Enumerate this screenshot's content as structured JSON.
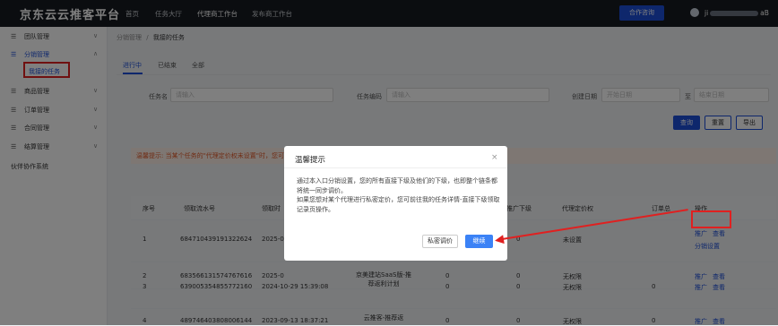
{
  "topbar": {
    "brand": "京东云云推客平台",
    "nav": [
      "首页",
      "任务大厅",
      "代理商工作台",
      "发布商工作台"
    ],
    "coop_button": "合作咨询",
    "user_prefix": "ji",
    "user_suffix": "aB"
  },
  "sidebar": {
    "items": [
      {
        "label": "团队管理",
        "chev": "∨"
      },
      {
        "label": "分销管理",
        "chev": "∧"
      },
      {
        "label": "商品管理",
        "chev": "∨"
      },
      {
        "label": "订单管理",
        "chev": "∨"
      },
      {
        "label": "合同管理",
        "chev": "∨"
      },
      {
        "label": "结算管理",
        "chev": "∨"
      }
    ],
    "sub_item": "我接的任务",
    "partner": "伙伴协作系统"
  },
  "breadcrumb": {
    "parent": "分销管理",
    "sep": "/",
    "current": "我接的任务"
  },
  "tabs": [
    "进行中",
    "已结束",
    "全部"
  ],
  "filters": {
    "task_name_label": "任务名",
    "task_name_placeholder": "请输入",
    "task_code_label": "任务编码",
    "task_code_placeholder": "请输入",
    "date_label": "创建日期",
    "start_placeholder": "开始日期",
    "date_sep": "至",
    "end_placeholder": "结束日期"
  },
  "buttons": {
    "query": "查询",
    "reset": "重置",
    "export": "导出"
  },
  "hint": "温馨提示: 当某个任务的\"代理定价权未设置\"时，您可",
  "table": {
    "headers": [
      "序号",
      "领取流水号",
      "领取时",
      "推广下级",
      "代理定价权",
      "订单总",
      "操作"
    ],
    "rows": [
      {
        "no": "1",
        "serial": "684710439191322624",
        "time": "2025-0",
        "task": "",
        "c1": "0",
        "c2": "0",
        "pricing": "未设置",
        "orders": "",
        "ops": [
          "推广",
          "查看",
          "分销设置"
        ]
      },
      {
        "no": "2",
        "serial": "683566131574767616",
        "time": "2025-0",
        "task": "",
        "c1": "0",
        "c2": "0",
        "pricing": "无权限",
        "orders": "",
        "ops": [
          "推广",
          "查看"
        ]
      },
      {
        "no": "3",
        "serial": "639005354855772160",
        "time": "2024-10-29 15:39:08",
        "task": "京美建站SaaS版-推荐返利计划",
        "c1": "0",
        "c2": "0",
        "pricing": "无权限",
        "orders": "0",
        "ops": [
          "推广",
          "查看"
        ]
      },
      {
        "no": "4",
        "serial": "489746403808006144",
        "time": "2023-09-13 18:37:21",
        "task": "云推客-推荐返",
        "c1": "0",
        "c2": "0",
        "pricing": "无权限",
        "orders": "0",
        "ops": [
          "推广",
          "查看"
        ]
      }
    ]
  },
  "modal": {
    "title": "温馨提示",
    "close": "×",
    "body1": "通过本入口分销设置，您的所有直接下级及他们的下级，也即整个链条都将统一同步调价。",
    "body2": "如果您想对某个代理进行私密定价，您可前往我的任务详情-直接下级领取记录页操作。",
    "secondary": "私密调价",
    "primary": "继续"
  }
}
